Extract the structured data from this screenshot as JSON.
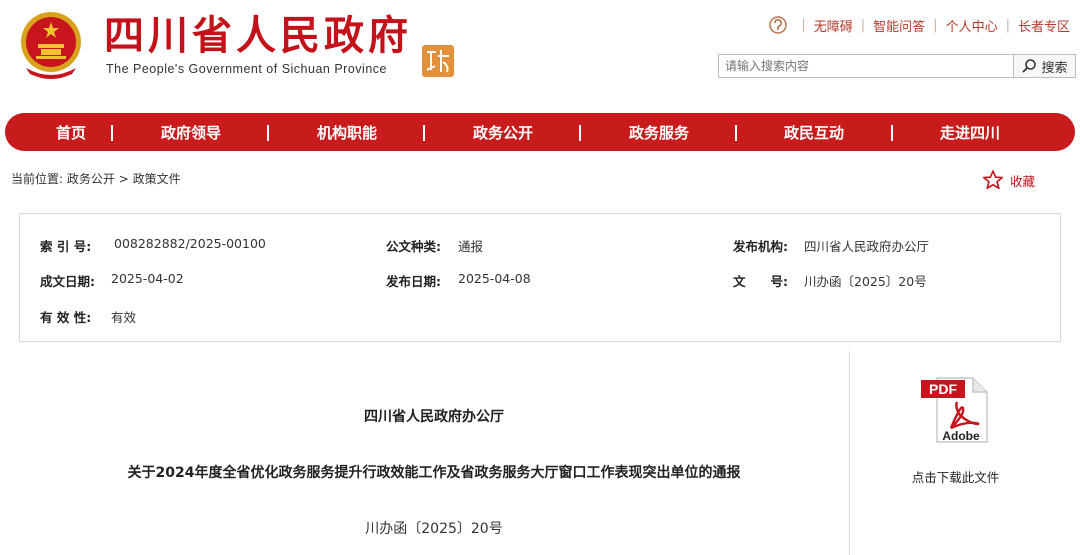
{
  "header": {
    "title": "四川省人民政府",
    "subtitle": "The People's Government of Sichuan Province",
    "top_links": [
      "无障碍",
      "智能问答",
      "个人中心",
      "长者专区"
    ],
    "search": {
      "placeholder": "请输入搜索内容",
      "button_label": "搜索"
    }
  },
  "nav": {
    "items": [
      "首页",
      "政府领导",
      "机构职能",
      "政务公开",
      "政务服务",
      "政民互动",
      "走进四川"
    ]
  },
  "breadcrumb": {
    "prefix": "当前位置:",
    "items": [
      "政务公开",
      "政策文件"
    ],
    "separator": ">"
  },
  "favorite": {
    "label": "收藏"
  },
  "info": {
    "index_label": "索 引 号:",
    "index_value": "008282882/2025-00100",
    "type_label": "公文种类:",
    "type_value": "通报",
    "publisher_label": "发布机构:",
    "publisher_value": "四川省人民政府办公厅",
    "created_label": "成文日期:",
    "created_value": "2025-04-02",
    "published_label": "发布日期:",
    "published_value": "2025-04-08",
    "doc_no_label": "文　　号:",
    "doc_no_value": "川办函〔2025〕20号",
    "validity_label": "有 效 性:",
    "validity_value": "有效"
  },
  "document": {
    "org": "四川省人民政府办公厅",
    "title": "关于2024年度全省优化政务服务提升行政效能工作及省政务服务大厅窗口工作表现突出单位的通报",
    "number": "川办函〔2025〕20号"
  },
  "side": {
    "pdf_badge": "PDF",
    "adobe": "Adobe",
    "download": "点击下载此文件"
  },
  "colors": {
    "brand_red": "#c81c1c",
    "title_red": "#c4121a"
  }
}
